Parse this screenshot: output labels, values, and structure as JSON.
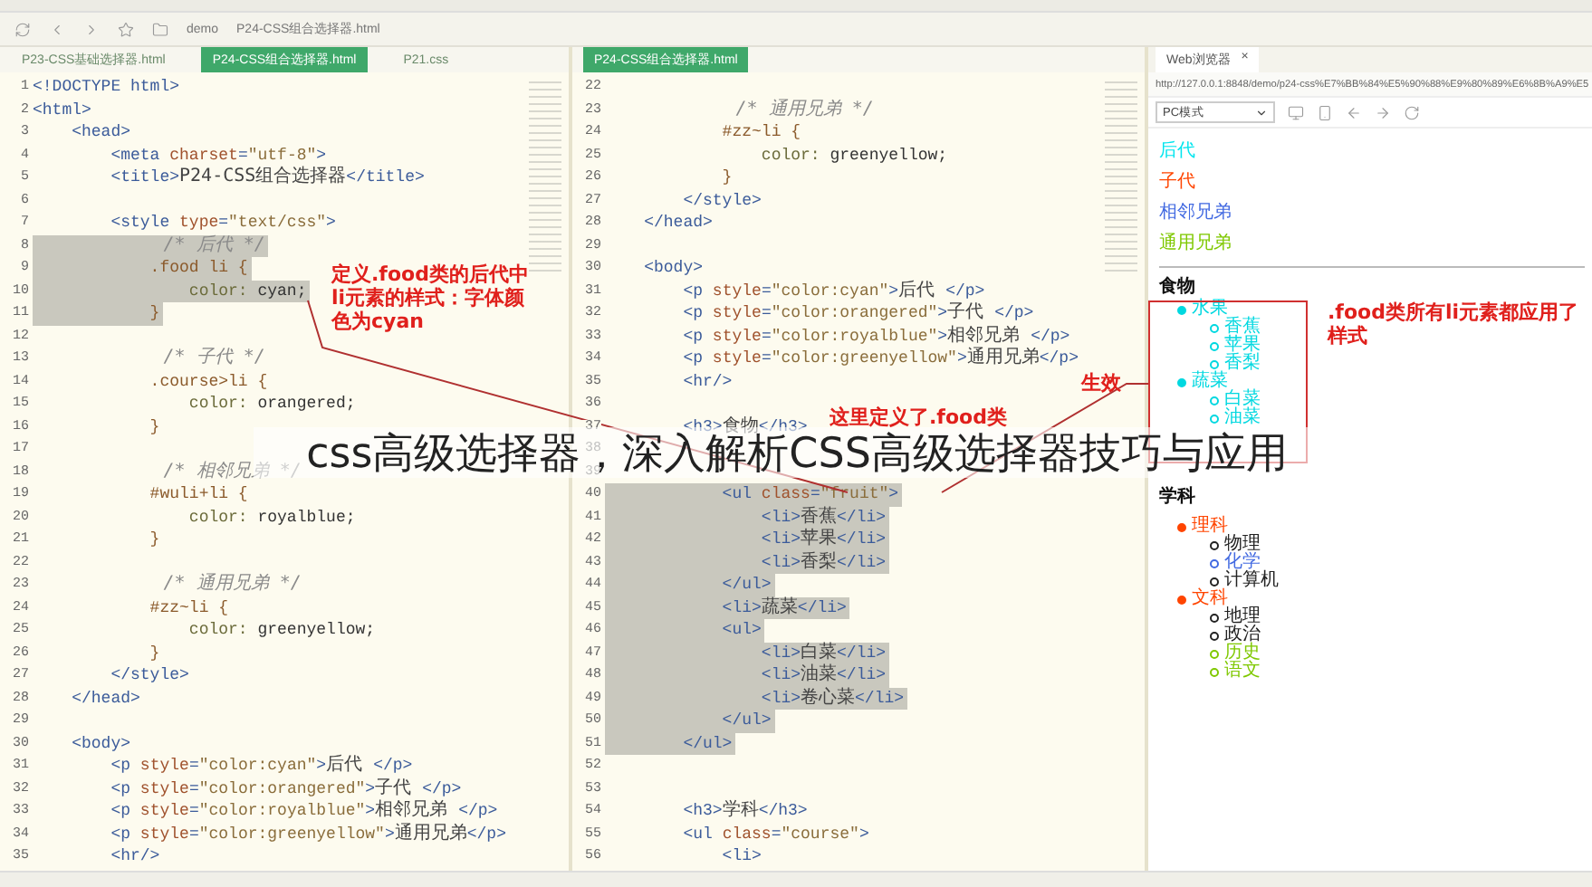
{
  "toolbar": {
    "breadcrumb": [
      "demo",
      "P24-CSS组合选择器.html"
    ]
  },
  "left_editor": {
    "tabs": [
      {
        "label": "P23-CSS基础选择器.html",
        "selected": false
      },
      {
        "label": "P24-CSS组合选择器.html",
        "selected": true
      },
      {
        "label": "P21.css",
        "selected": false
      }
    ],
    "lines": [
      {
        "num": "1",
        "highlighted": false,
        "parts": [
          {
            "kind": "tag",
            "text": "<!DOCTYPE html>"
          }
        ]
      },
      {
        "num": "2",
        "highlighted": false,
        "parts": [
          {
            "kind": "tag",
            "text": "<html>"
          }
        ]
      },
      {
        "num": "3",
        "highlighted": false,
        "parts": [
          {
            "kind": "tag",
            "text": "    <head>"
          }
        ]
      },
      {
        "num": "4",
        "highlighted": false,
        "parts": [
          {
            "kind": "tag",
            "text": "        <meta "
          },
          {
            "kind": "attr",
            "text": "charset"
          },
          {
            "kind": "tag",
            "text": "="
          },
          {
            "kind": "str",
            "text": "\"utf-8\""
          },
          {
            "kind": "tag",
            "text": ">"
          }
        ]
      },
      {
        "num": "5",
        "highlighted": false,
        "parts": [
          {
            "kind": "tag",
            "text": "        <title>"
          },
          {
            "kind": "text",
            "text": "P24-CSS组合选择器"
          },
          {
            "kind": "tag",
            "text": "</title>"
          }
        ]
      },
      {
        "num": "6"
      },
      {
        "num": "7",
        "highlighted": false,
        "parts": [
          {
            "kind": "tag",
            "text": "        <style "
          },
          {
            "kind": "attr",
            "text": "type"
          },
          {
            "kind": "tag",
            "text": "="
          },
          {
            "kind": "str",
            "text": "\"text/css\""
          },
          {
            "kind": "tag",
            "text": ">"
          }
        ]
      },
      {
        "num": "8",
        "highlighted": true,
        "parts": [
          {
            "kind": "comment",
            "text": "            /* 后代 */"
          }
        ]
      },
      {
        "num": "9",
        "highlighted": true,
        "parts": [
          {
            "kind": "sel",
            "text": "            .food li {"
          }
        ]
      },
      {
        "num": "10",
        "highlighted": true,
        "parts": [
          {
            "kind": "prop",
            "text": "                color: "
          },
          {
            "kind": "val",
            "text": "cyan;"
          }
        ]
      },
      {
        "num": "11",
        "highlighted": true,
        "parts": [
          {
            "kind": "sel",
            "text": "            }"
          }
        ]
      },
      {
        "num": "12"
      },
      {
        "num": "13",
        "highlighted": false,
        "parts": [
          {
            "kind": "comment",
            "text": "            /* 子代 */"
          }
        ]
      },
      {
        "num": "14",
        "highlighted": false,
        "parts": [
          {
            "kind": "sel",
            "text": "            .course>li {"
          }
        ]
      },
      {
        "num": "15",
        "highlighted": false,
        "parts": [
          {
            "kind": "prop",
            "text": "                color: "
          },
          {
            "kind": "val",
            "text": "orangered;"
          }
        ]
      },
      {
        "num": "16",
        "highlighted": false,
        "parts": [
          {
            "kind": "sel",
            "text": "            }"
          }
        ]
      },
      {
        "num": "17"
      },
      {
        "num": "18",
        "highlighted": false,
        "parts": [
          {
            "kind": "comment",
            "text": "            /* 相邻兄弟 */"
          }
        ]
      },
      {
        "num": "19",
        "highlighted": false,
        "parts": [
          {
            "kind": "sel",
            "text": "            #wuli+li {"
          }
        ]
      },
      {
        "num": "20",
        "highlighted": false,
        "parts": [
          {
            "kind": "prop",
            "text": "                color: "
          },
          {
            "kind": "val",
            "text": "royalblue;"
          }
        ]
      },
      {
        "num": "21",
        "highlighted": false,
        "parts": [
          {
            "kind": "sel",
            "text": "            }"
          }
        ]
      },
      {
        "num": "22"
      },
      {
        "num": "23",
        "highlighted": false,
        "parts": [
          {
            "kind": "comment",
            "text": "            /* 通用兄弟 */"
          }
        ]
      },
      {
        "num": "24",
        "highlighted": false,
        "parts": [
          {
            "kind": "sel",
            "text": "            #zz~li {"
          }
        ]
      },
      {
        "num": "25",
        "highlighted": false,
        "parts": [
          {
            "kind": "prop",
            "text": "                color: "
          },
          {
            "kind": "val",
            "text": "greenyellow;"
          }
        ]
      },
      {
        "num": "26",
        "highlighted": false,
        "parts": [
          {
            "kind": "sel",
            "text": "            }"
          }
        ]
      },
      {
        "num": "27",
        "highlighted": false,
        "parts": [
          {
            "kind": "tag",
            "text": "        </style>"
          }
        ]
      },
      {
        "num": "28",
        "highlighted": false,
        "parts": [
          {
            "kind": "tag",
            "text": "    </head>"
          }
        ]
      },
      {
        "num": "29"
      },
      {
        "num": "30",
        "highlighted": false,
        "parts": [
          {
            "kind": "tag",
            "text": "    <body>"
          }
        ]
      },
      {
        "num": "31",
        "highlighted": false,
        "parts": [
          {
            "kind": "tag",
            "text": "        <p "
          },
          {
            "kind": "attr",
            "text": "style"
          },
          {
            "kind": "tag",
            "text": "="
          },
          {
            "kind": "str",
            "text": "\"color:cyan\""
          },
          {
            "kind": "tag",
            "text": ">"
          },
          {
            "kind": "text",
            "text": "后代 "
          },
          {
            "kind": "tag",
            "text": "</p>"
          }
        ]
      },
      {
        "num": "32",
        "highlighted": false,
        "parts": [
          {
            "kind": "tag",
            "text": "        <p "
          },
          {
            "kind": "attr",
            "text": "style"
          },
          {
            "kind": "tag",
            "text": "="
          },
          {
            "kind": "str",
            "text": "\"color:orangered\""
          },
          {
            "kind": "tag",
            "text": ">"
          },
          {
            "kind": "text",
            "text": "子代 "
          },
          {
            "kind": "tag",
            "text": "</p>"
          }
        ]
      },
      {
        "num": "33",
        "highlighted": false,
        "parts": [
          {
            "kind": "tag",
            "text": "        <p "
          },
          {
            "kind": "attr",
            "text": "style"
          },
          {
            "kind": "tag",
            "text": "="
          },
          {
            "kind": "str",
            "text": "\"color:royalblue\""
          },
          {
            "kind": "tag",
            "text": ">"
          },
          {
            "kind": "text",
            "text": "相邻兄弟 "
          },
          {
            "kind": "tag",
            "text": "</p>"
          }
        ]
      },
      {
        "num": "34",
        "highlighted": false,
        "parts": [
          {
            "kind": "tag",
            "text": "        <p "
          },
          {
            "kind": "attr",
            "text": "style"
          },
          {
            "kind": "tag",
            "text": "="
          },
          {
            "kind": "str",
            "text": "\"color:greenyellow\""
          },
          {
            "kind": "tag",
            "text": ">"
          },
          {
            "kind": "text",
            "text": "通用兄弟"
          },
          {
            "kind": "tag",
            "text": "</p>"
          }
        ]
      },
      {
        "num": "35",
        "highlighted": false,
        "parts": [
          {
            "kind": "tag",
            "text": "        <hr/>"
          }
        ]
      }
    ]
  },
  "right_editor": {
    "tabs": [
      {
        "label": "P24-CSS组合选择器.html",
        "selected": true
      }
    ],
    "lines": [
      {
        "num": "22"
      },
      {
        "num": "23",
        "highlighted": false,
        "parts": [
          {
            "kind": "comment",
            "text": "            /* 通用兄弟 */"
          }
        ]
      },
      {
        "num": "24",
        "highlighted": false,
        "parts": [
          {
            "kind": "sel",
            "text": "            #zz~li {"
          }
        ]
      },
      {
        "num": "25",
        "highlighted": false,
        "parts": [
          {
            "kind": "prop",
            "text": "                color: "
          },
          {
            "kind": "val",
            "text": "greenyellow;"
          }
        ]
      },
      {
        "num": "26",
        "highlighted": false,
        "parts": [
          {
            "kind": "sel",
            "text": "            }"
          }
        ]
      },
      {
        "num": "27",
        "highlighted": false,
        "parts": [
          {
            "kind": "tag",
            "text": "        </style>"
          }
        ]
      },
      {
        "num": "28",
        "highlighted": false,
        "parts": [
          {
            "kind": "tag",
            "text": "    </head>"
          }
        ]
      },
      {
        "num": "29"
      },
      {
        "num": "30",
        "highlighted": false,
        "parts": [
          {
            "kind": "tag",
            "text": "    <body>"
          }
        ]
      },
      {
        "num": "31",
        "highlighted": false,
        "parts": [
          {
            "kind": "tag",
            "text": "        <p "
          },
          {
            "kind": "attr",
            "text": "style"
          },
          {
            "kind": "tag",
            "text": "="
          },
          {
            "kind": "str",
            "text": "\"color:cyan\""
          },
          {
            "kind": "tag",
            "text": ">"
          },
          {
            "kind": "text",
            "text": "后代 "
          },
          {
            "kind": "tag",
            "text": "</p>"
          }
        ]
      },
      {
        "num": "32",
        "highlighted": false,
        "parts": [
          {
            "kind": "tag",
            "text": "        <p "
          },
          {
            "kind": "attr",
            "text": "style"
          },
          {
            "kind": "tag",
            "text": "="
          },
          {
            "kind": "str",
            "text": "\"color:orangered\""
          },
          {
            "kind": "tag",
            "text": ">"
          },
          {
            "kind": "text",
            "text": "子代 "
          },
          {
            "kind": "tag",
            "text": "</p>"
          }
        ]
      },
      {
        "num": "33",
        "highlighted": false,
        "parts": [
          {
            "kind": "tag",
            "text": "        <p "
          },
          {
            "kind": "attr",
            "text": "style"
          },
          {
            "kind": "tag",
            "text": "="
          },
          {
            "kind": "str",
            "text": "\"color:royalblue\""
          },
          {
            "kind": "tag",
            "text": ">"
          },
          {
            "kind": "text",
            "text": "相邻兄弟 "
          },
          {
            "kind": "tag",
            "text": "</p>"
          }
        ]
      },
      {
        "num": "34",
        "highlighted": false,
        "parts": [
          {
            "kind": "tag",
            "text": "        <p "
          },
          {
            "kind": "attr",
            "text": "style"
          },
          {
            "kind": "tag",
            "text": "="
          },
          {
            "kind": "str",
            "text": "\"color:greenyellow\""
          },
          {
            "kind": "tag",
            "text": ">"
          },
          {
            "kind": "text",
            "text": "通用兄弟"
          },
          {
            "kind": "tag",
            "text": "</p>"
          }
        ]
      },
      {
        "num": "35",
        "highlighted": false,
        "parts": [
          {
            "kind": "tag",
            "text": "        <hr/>"
          }
        ]
      },
      {
        "num": "36"
      },
      {
        "num": "37",
        "highlighted": false,
        "parts": [
          {
            "kind": "tag",
            "text": "        <h3>"
          },
          {
            "kind": "text",
            "text": "食物"
          },
          {
            "kind": "tag",
            "text": "</h3>"
          }
        ]
      },
      {
        "num": "38"
      },
      {
        "num": "39"
      },
      {
        "num": "40",
        "highlighted": true,
        "parts": [
          {
            "kind": "tag",
            "text": "            <ul "
          },
          {
            "kind": "attr",
            "text": "class"
          },
          {
            "kind": "tag",
            "text": "="
          },
          {
            "kind": "str",
            "text": "\"fruit\""
          },
          {
            "kind": "tag",
            "text": ">"
          }
        ]
      },
      {
        "num": "41",
        "highlighted": true,
        "parts": [
          {
            "kind": "tag",
            "text": "                <li>"
          },
          {
            "kind": "text",
            "text": "香蕉"
          },
          {
            "kind": "tag",
            "text": "</li>"
          }
        ]
      },
      {
        "num": "42",
        "highlighted": true,
        "parts": [
          {
            "kind": "tag",
            "text": "                <li>"
          },
          {
            "kind": "text",
            "text": "苹果"
          },
          {
            "kind": "tag",
            "text": "</li>"
          }
        ]
      },
      {
        "num": "43",
        "highlighted": true,
        "parts": [
          {
            "kind": "tag",
            "text": "                <li>"
          },
          {
            "kind": "text",
            "text": "香梨"
          },
          {
            "kind": "tag",
            "text": "</li>"
          }
        ]
      },
      {
        "num": "44",
        "highlighted": true,
        "parts": [
          {
            "kind": "tag",
            "text": "            </ul>"
          }
        ]
      },
      {
        "num": "45",
        "highlighted": true,
        "parts": [
          {
            "kind": "tag",
            "text": "            <li>"
          },
          {
            "kind": "text",
            "text": "蔬菜"
          },
          {
            "kind": "tag",
            "text": "</li>"
          }
        ]
      },
      {
        "num": "46",
        "highlighted": true,
        "parts": [
          {
            "kind": "tag",
            "text": "            <ul>"
          }
        ]
      },
      {
        "num": "47",
        "highlighted": true,
        "parts": [
          {
            "kind": "tag",
            "text": "                <li>"
          },
          {
            "kind": "text",
            "text": "白菜"
          },
          {
            "kind": "tag",
            "text": "</li>"
          }
        ]
      },
      {
        "num": "48",
        "highlighted": true,
        "parts": [
          {
            "kind": "tag",
            "text": "                <li>"
          },
          {
            "kind": "text",
            "text": "油菜"
          },
          {
            "kind": "tag",
            "text": "</li>"
          }
        ]
      },
      {
        "num": "49",
        "highlighted": true,
        "parts": [
          {
            "kind": "tag",
            "text": "                <li>"
          },
          {
            "kind": "text",
            "text": "卷心菜"
          },
          {
            "kind": "tag",
            "text": "</li>"
          }
        ]
      },
      {
        "num": "50",
        "highlighted": true,
        "parts": [
          {
            "kind": "tag",
            "text": "            </ul>"
          }
        ]
      },
      {
        "num": "51",
        "highlighted": true,
        "parts": [
          {
            "kind": "tag",
            "text": "        </ul>"
          }
        ]
      },
      {
        "num": "52"
      },
      {
        "num": "53"
      },
      {
        "num": "54",
        "highlighted": false,
        "parts": [
          {
            "kind": "tag",
            "text": "        <h3>"
          },
          {
            "kind": "text",
            "text": "学科"
          },
          {
            "kind": "tag",
            "text": "</h3>"
          }
        ]
      },
      {
        "num": "55",
        "highlighted": false,
        "parts": [
          {
            "kind": "tag",
            "text": "        <ul "
          },
          {
            "kind": "attr",
            "text": "class"
          },
          {
            "kind": "tag",
            "text": "="
          },
          {
            "kind": "str",
            "text": "\"course\""
          },
          {
            "kind": "tag",
            "text": ">"
          }
        ]
      },
      {
        "num": "56",
        "highlighted": false,
        "parts": [
          {
            "kind": "tag",
            "text": "            <li>"
          }
        ]
      }
    ]
  },
  "browser": {
    "tab": "Web浏览器",
    "tab_close": "×",
    "url": "http://127.0.0.1:8848/demo/p24-css%E7%BB%84%E5%90%88%E9%80%89%E6%8B%A9%E5",
    "mode": "PC模式",
    "paragraphs": [
      {
        "text": "后代",
        "color": "#00e5ee"
      },
      {
        "text": "子代",
        "color": "#ff4500"
      },
      {
        "text": "相邻兄弟",
        "color": "#4169e1"
      },
      {
        "text": "通用兄弟",
        "color": "#7fc800"
      }
    ],
    "food_heading": "食物",
    "food_list": [
      {
        "text": "水果",
        "color": "#00d8e0",
        "children": [
          {
            "text": "香蕉",
            "color": "#00d8e0"
          },
          {
            "text": "苹果",
            "color": "#00d8e0"
          },
          {
            "text": "香梨",
            "color": "#00d8e0"
          }
        ]
      },
      {
        "text": "蔬菜",
        "color": "#00d8e0",
        "children": [
          {
            "text": "白菜",
            "color": "#00d8e0"
          },
          {
            "text": "油菜",
            "color": "#00d8e0"
          }
        ]
      }
    ],
    "course_heading": "学科",
    "course_list": [
      {
        "text": "理科",
        "color": "#ff4500",
        "children": [
          {
            "text": "物理",
            "color": "#222222"
          },
          {
            "text": "化学",
            "color": "#4169e1"
          },
          {
            "text": "计算机",
            "color": "#222222"
          }
        ]
      },
      {
        "text": "文科",
        "color": "#ff4500",
        "children": [
          {
            "text": "地理",
            "color": "#222222"
          },
          {
            "text": "政治",
            "color": "#222222"
          },
          {
            "text": "历史",
            "color": "#7fc800"
          },
          {
            "text": "语文",
            "color": "#7fc800"
          }
        ]
      }
    ]
  },
  "annotations": {
    "descendant_note": "定义.food类的后代中li元素的样式：字体颜色为cyan",
    "defined_note": "这里定义了.food类",
    "effect_note": "生效",
    "result_note": ".food类所有li元素都应用了样式"
  },
  "caption": "css高级选择器，深入解析CSS高级选择器技巧与应用"
}
